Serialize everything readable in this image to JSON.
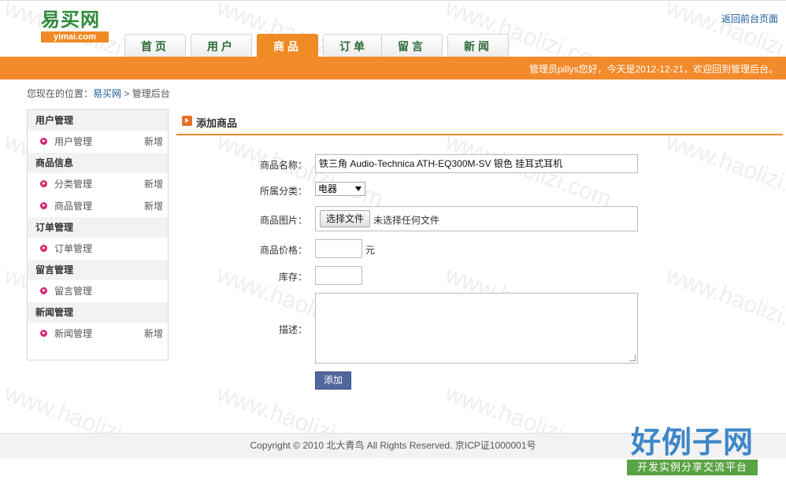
{
  "header": {
    "logo_cn": "易买网",
    "logo_en": "yimai.com",
    "back_link": "返回前台页面",
    "welcome": "管理员pillys您好，今天是2012-12-21，欢迎回到管理后台。"
  },
  "nav": {
    "tabs": [
      {
        "label": "首页",
        "active": false
      },
      {
        "label": "用户",
        "active": false
      },
      {
        "label": "商品",
        "active": true
      },
      {
        "label": "订单",
        "active": false
      },
      {
        "label": "留言",
        "active": false
      },
      {
        "label": "新闻",
        "active": false
      }
    ]
  },
  "breadcrumb": {
    "prefix": "您现在的位置：",
    "site": "易买网",
    "separator": ">",
    "current": "管理后台"
  },
  "sidebar": {
    "groups": [
      {
        "title": "用户管理",
        "items": [
          {
            "label": "用户管理",
            "add": "新增"
          }
        ]
      },
      {
        "title": "商品信息",
        "items": [
          {
            "label": "分类管理",
            "add": "新增"
          },
          {
            "label": "商品管理",
            "add": "新增"
          }
        ]
      },
      {
        "title": "订单管理",
        "items": [
          {
            "label": "订单管理",
            "add": ""
          }
        ]
      },
      {
        "title": "留言管理",
        "items": [
          {
            "label": "留言管理",
            "add": ""
          }
        ]
      },
      {
        "title": "新闻管理",
        "items": [
          {
            "label": "新闻管理",
            "add": "新增"
          }
        ]
      }
    ]
  },
  "form": {
    "title": "添加商品",
    "name_label": "商品名称：",
    "name_value": "铁三角 Audio-Technica ATH-EQ300M-SV 银色 挂耳式耳机",
    "category_label": "所属分类：",
    "category_value": "电器",
    "image_label": "商品图片：",
    "file_button": "选择文件",
    "file_status": "未选择任何文件",
    "price_label": "商品价格：",
    "price_value": "",
    "price_unit": "元",
    "stock_label": "库存：",
    "stock_value": "",
    "desc_label": "描述：",
    "desc_value": "",
    "submit": "添加"
  },
  "footer": {
    "copyright": "Copyright © 2010 北大青鸟 All Rights Reserved. 京ICP证1000001号"
  },
  "watermark": {
    "text": "www.haolizi.com",
    "brand_cn": "好例子网",
    "brand_sub": "开发实例分享交流平台"
  },
  "colors": {
    "accent_orange": "#f38a2c",
    "logo_green": "#2f8a3a",
    "button_blue": "#52679e",
    "bullet_pink": "#d9256f",
    "link_blue": "#1a5a9c"
  }
}
